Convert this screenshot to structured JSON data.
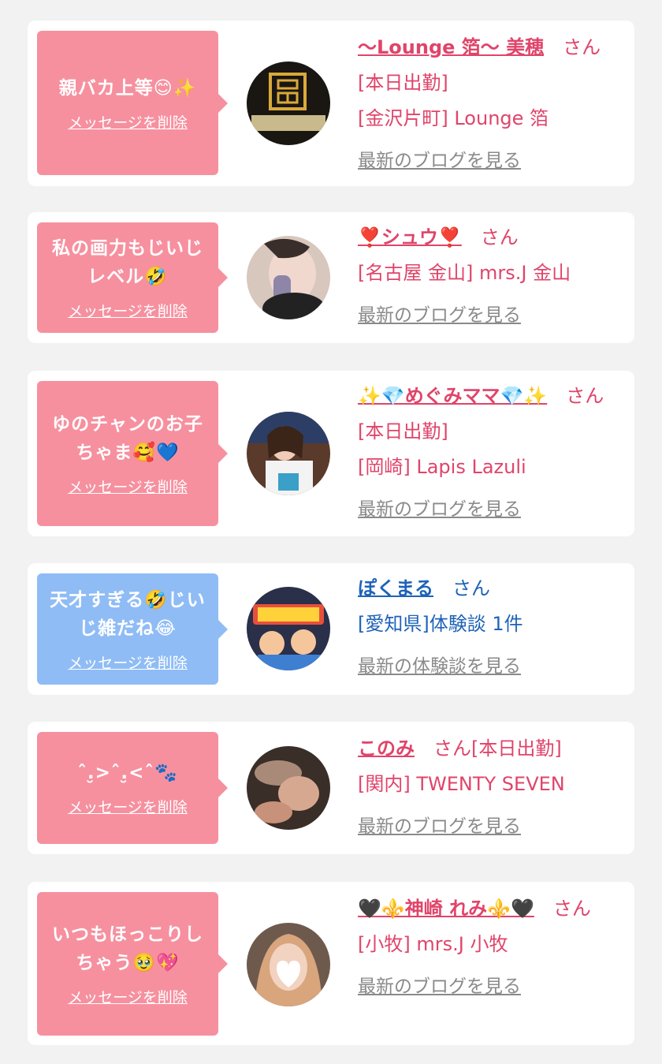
{
  "colors": {
    "pink_bubble": "#f6909f",
    "blue_bubble": "#8fbcf5",
    "pink_text": "#e0446a",
    "blue_text": "#1e63b8",
    "link_gray": "#8a8a8a"
  },
  "messages": [
    {
      "bubble_text": "親バカ上等😊✨",
      "delete_label": "メッセージを削除",
      "name": "〜Lounge 箔〜 美穂",
      "suffix": "さん",
      "status": "[本日出勤]",
      "shop": "[金沢片町] Lounge 箔",
      "link": "最新のブログを見る"
    },
    {
      "bubble_text": "私の画力もじいじレベル🤣",
      "delete_label": "メッセージを削除",
      "name": "❣️シュウ❣️",
      "suffix": "さん",
      "shop": "[名古屋 金山] mrs.J 金山",
      "link": "最新のブログを見る"
    },
    {
      "bubble_text": "ゆのチャンのお子ちゃま🥰💙",
      "delete_label": "メッセージを削除",
      "name": "✨💎めぐみママ💎✨",
      "suffix": "さん",
      "status": "[本日出勤]",
      "shop": "[岡崎] Lapis Lazuli",
      "link": "最新のブログを見る"
    },
    {
      "bubble_text": "天才すぎる🤣じいじ雑だね😂",
      "delete_label": "メッセージを削除",
      "name": "ぽくまる",
      "suffix": "さん",
      "shop": "[愛知県]体験談 1件",
      "link": "最新の体験談を見る"
    },
    {
      "bubble_text": "ˆ.̮>ˆ.̮<ˆ🐾",
      "delete_label": "メッセージを削除",
      "name": "このみ",
      "suffix": "さん",
      "status": "[本日出勤]",
      "shop": "[関内] TWENTY SEVEN",
      "link": "最新のブログを見る"
    },
    {
      "bubble_text": "いつもほっこりしちゃう🥹💖",
      "delete_label": "メッセージを削除",
      "name": "🖤⚜️神崎 れみ⚜️🖤",
      "suffix": "さん",
      "shop": "[小牧] mrs.J 小牧",
      "link": "最新のブログを見る"
    }
  ]
}
